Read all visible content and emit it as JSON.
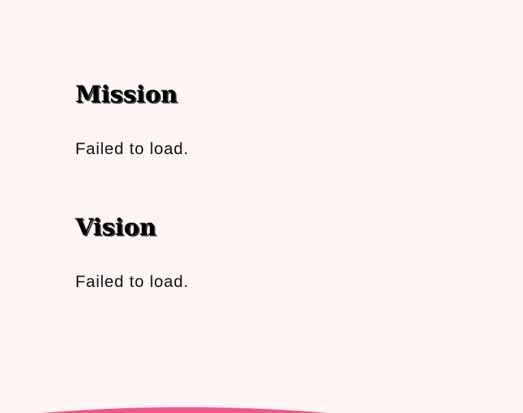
{
  "mission": {
    "title": "Mission",
    "text": "Failed to load."
  },
  "vision": {
    "title": "Vision",
    "text": "Failed to load."
  },
  "colors": {
    "background": "#fff5f5",
    "heading": "#000000",
    "body_text": "#111111",
    "accent": "#f0568a"
  }
}
